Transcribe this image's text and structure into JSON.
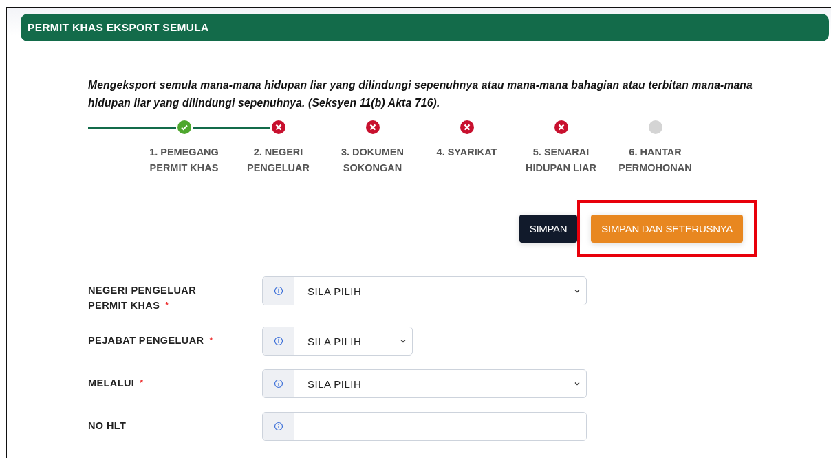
{
  "header": {
    "title": "PERMIT KHAS EKSPORT SEMULA"
  },
  "description": "Mengeksport semula mana-mana hidupan liar yang dilindungi sepenuhnya atau mana-mana bahagian atau terbitan mana-mana hidupan liar yang dilindungi sepenuhnya. (Seksyen 11(b) Akta 716).",
  "steps": [
    {
      "label": "1. PEMEGANG PERMIT KHAS",
      "kind": "done"
    },
    {
      "label": "2. NEGERI PENGELUAR",
      "kind": "error"
    },
    {
      "label": "3. DOKUMEN SOKONGAN",
      "kind": "error"
    },
    {
      "label": "4. SYARIKAT",
      "kind": "error"
    },
    {
      "label": "5. SENARAI HIDUPAN LIAR",
      "kind": "error"
    },
    {
      "label": "6. HANTAR PERMOHONAN",
      "kind": "pending"
    }
  ],
  "buttons": [
    {
      "label": "SIMPAN",
      "kind": "dark",
      "highlighted": false
    },
    {
      "label": "SIMPAN DAN SETERUSNYA",
      "kind": "orange",
      "highlighted": true
    }
  ],
  "fields": [
    {
      "label": "NEGERI PENGELUAR PERMIT KHAS",
      "marker": "*",
      "kind": "select",
      "value": "SILA PILIH"
    },
    {
      "label": "PEJABAT PENGELUAR",
      "marker": "*",
      "kind": "shortselect",
      "value": "SILA PILIH"
    },
    {
      "label": "MELALUI",
      "marker": "*",
      "kind": "select",
      "value": "SILA PILIH"
    },
    {
      "label": "NO HLT",
      "kind": "text"
    }
  ]
}
